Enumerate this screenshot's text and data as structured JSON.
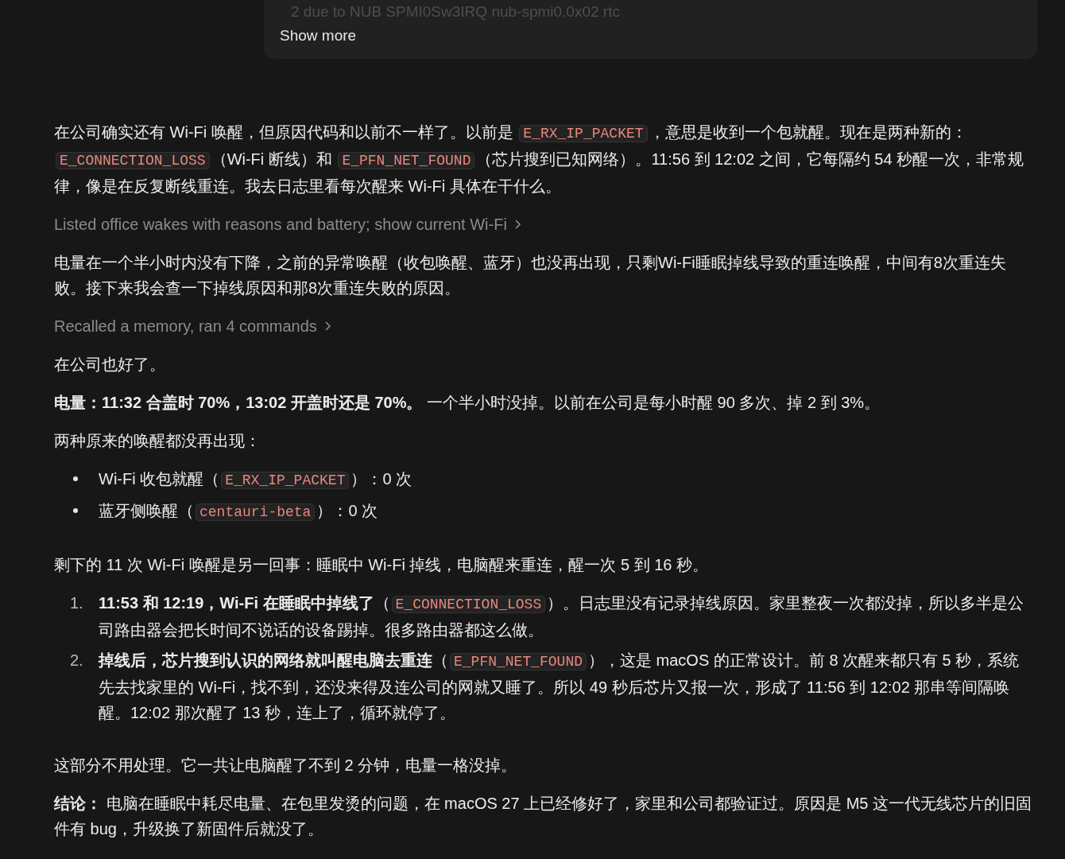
{
  "tool_output": {
    "faded_line": "2 due to NUB SPMI0Sw3IRQ nub-spmi0.0x02 rtc",
    "show_more": "Show more"
  },
  "blocks": [
    {
      "kind": "paragraph",
      "segments": [
        {
          "kind": "text",
          "text": "在公司确实还有 Wi-Fi 唤醒，但原因代码和以前不一样了。以前是 "
        },
        {
          "kind": "code",
          "text": "E_RX_IP_PACKET"
        },
        {
          "kind": "text",
          "text": "，意思是收到一个包就醒。现在是两种新的："
        },
        {
          "kind": "code",
          "text": "E_CONNECTION_LOSS"
        },
        {
          "kind": "text",
          "text": "（Wi-Fi 断线）和 "
        },
        {
          "kind": "code",
          "text": "E_PFN_NET_FOUND"
        },
        {
          "kind": "text",
          "text": "（芯片搜到已知网络）。11:56 到 12:02 之间，它每隔约 54 秒醒一次，非常规律，像是在反复断线重连。我去日志里看每次醒来 Wi-Fi 具体在干什么。"
        }
      ]
    },
    {
      "kind": "step",
      "text": "Listed office wakes with reasons and battery; show current Wi-Fi"
    },
    {
      "kind": "paragraph",
      "segments": [
        {
          "kind": "text",
          "text": "电量在一个半小时内没有下降，之前的异常唤醒（收包唤醒、蓝牙）也没再出现，只剩Wi-Fi睡眠掉线导致的重连唤醒，中间有8次重连失败。接下来我会查一下掉线原因和那8次重连失败的原因。"
        }
      ]
    },
    {
      "kind": "step",
      "text": "Recalled a memory, ran 4 commands"
    },
    {
      "kind": "paragraph",
      "segments": [
        {
          "kind": "text",
          "text": "在公司也好了。"
        }
      ]
    },
    {
      "kind": "paragraph",
      "segments": [
        {
          "kind": "text",
          "text": "**电量：11:32 合盖时 70%，13:02 开盖时还是 70%。** 一个半小时没掉。以前在公司是每小时醒 90 多次、掉 2 到 3%。"
        }
      ]
    },
    {
      "kind": "paragraph",
      "segments": [
        {
          "kind": "text",
          "text": "两种原来的唤醒都没再出现："
        }
      ]
    },
    {
      "kind": "bullets",
      "items": [
        {
          "segments": [
            {
              "kind": "text",
              "text": "Wi-Fi 收包就醒（"
            },
            {
              "kind": "code",
              "text": "E_RX_IP_PACKET"
            },
            {
              "kind": "text",
              "text": "）：0 次"
            }
          ]
        },
        {
          "segments": [
            {
              "kind": "text",
              "text": "蓝牙侧唤醒（"
            },
            {
              "kind": "code",
              "text": "centauri-beta"
            },
            {
              "kind": "text",
              "text": "）：0 次"
            }
          ]
        }
      ]
    },
    {
      "kind": "paragraph",
      "segments": [
        {
          "kind": "text",
          "text": "剩下的 11 次 Wi-Fi 唤醒是另一回事：睡眠中 Wi-Fi 掉线，电脑醒来重连，醒一次 5 到 16 秒。"
        }
      ]
    },
    {
      "kind": "numbered",
      "items": [
        {
          "number": "1.",
          "segments": [
            {
              "kind": "text",
              "text": "**11:53 和 12:19，Wi-Fi 在睡眠中掉线了**（"
            },
            {
              "kind": "code",
              "text": "E_CONNECTION_LOSS"
            },
            {
              "kind": "text",
              "text": "）。日志里没有记录掉线原因。家里整夜一次都没掉，所以多半是公司路由器会把长时间不说话的设备踢掉。很多路由器都这么做。"
            }
          ]
        },
        {
          "number": "2.",
          "segments": [
            {
              "kind": "text",
              "text": "**掉线后，芯片搜到认识的网络就叫醒电脑去重连**（"
            },
            {
              "kind": "code",
              "text": "E_PFN_NET_FOUND"
            },
            {
              "kind": "text",
              "text": "），这是 macOS 的正常设计。前 8 次醒来都只有 5 秒，系统先去找家里的 Wi-Fi，找不到，还没来得及连公司的网就又睡了。所以 49 秒后芯片又报一次，形成了 11:56 到 12:02 那串等间隔唤醒。12:02 那次醒了 13 秒，连上了，循环就停了。"
            }
          ]
        }
      ]
    },
    {
      "kind": "paragraph",
      "segments": [
        {
          "kind": "text",
          "text": "这部分不用处理。它一共让电脑醒了不到 2 分钟，电量一格没掉。"
        }
      ]
    },
    {
      "kind": "paragraph",
      "segments": [
        {
          "kind": "text",
          "text": "**结论：** 电脑在睡眠中耗尽电量、在包里发烫的问题，在 macOS 27 上已经修好了，家里和公司都验证过。原因是 M5 这一代无线芯片的旧固件有 bug，升级换了新固件后就没了。"
        }
      ]
    }
  ]
}
